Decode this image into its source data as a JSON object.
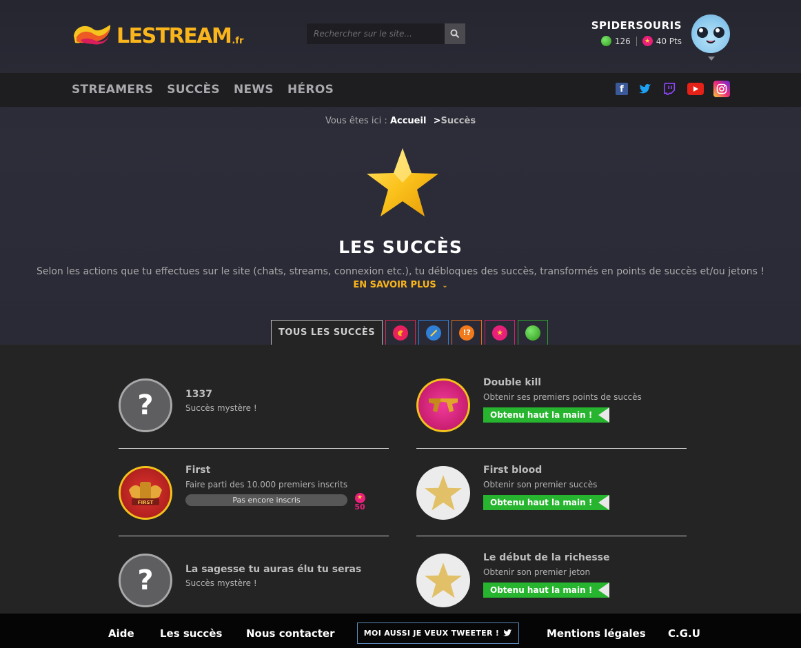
{
  "header": {
    "logo_text": "LESTREAM",
    "logo_tld": ".fr",
    "search_placeholder": "Rechercher sur le site...",
    "user": {
      "name": "SPIDERSOURIS",
      "coins": "126",
      "points": "40 Pts"
    }
  },
  "nav": {
    "items": [
      "STREAMERS",
      "SUCCÈS",
      "NEWS",
      "HÉROS"
    ]
  },
  "breadcrumb": {
    "prefix": "Vous êtes ici :",
    "home": "Accueil",
    "current": "Succès"
  },
  "hero": {
    "title": "LES SUCCÈS",
    "intro": "Selon les actions que tu effectues sur le site (chats, streams, connexion etc.), tu débloques des succès, transformés en points de succès et/ou jetons !",
    "learn_more": "EN SAVOIR PLUS"
  },
  "tabs": {
    "all_label": "TOUS LES SUCCÈS"
  },
  "achievements": [
    {
      "title": "1337",
      "desc": "Succès mystère !"
    },
    {
      "title": "Double kill",
      "desc": "Obtenir ses premiers points de succès",
      "status": "Obtenu haut la main !"
    },
    {
      "title": "First",
      "desc": "Faire parti des 10.000 premiers inscrits",
      "progress": "Pas encore inscris",
      "reward": "50",
      "badge_text": "FIRST"
    },
    {
      "title": "First blood",
      "desc": "Obtenir son premier succès",
      "status": "Obtenu haut la main !"
    },
    {
      "title": "La sagesse tu auras élu tu seras",
      "desc": "Succès mystère !"
    },
    {
      "title": "Le début de la richesse",
      "desc": "Obtenir son premier jeton",
      "status": "Obtenu haut la main !"
    }
  ],
  "footer": {
    "help": "Aide",
    "achievements": "Les succès",
    "contact": "Nous contacter",
    "tweet": "MOI AUSSI JE VEUX TWEETER !",
    "legal": "Mentions légales",
    "cgu": "C.G.U"
  },
  "colors": {
    "accent": "#f9b51b",
    "success": "#27b52f",
    "pink": "#e8207a"
  }
}
